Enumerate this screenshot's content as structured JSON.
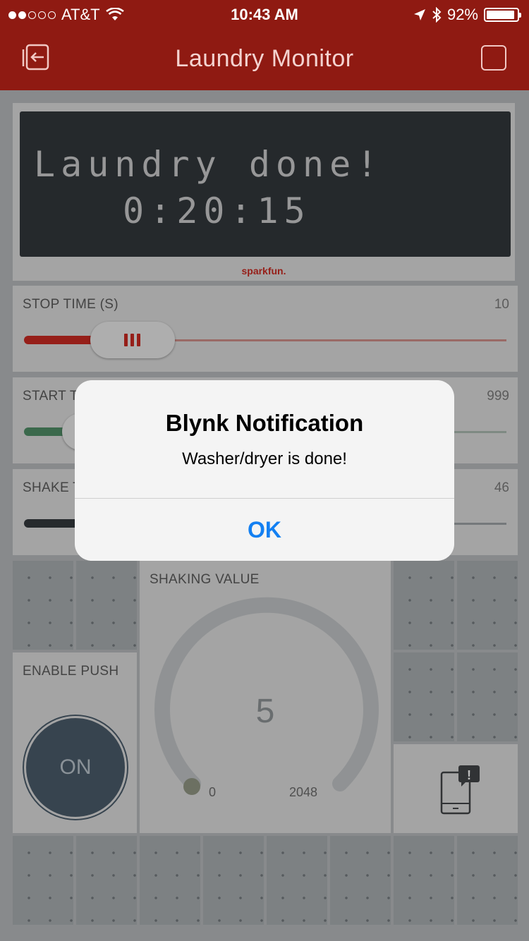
{
  "status_bar": {
    "carrier": "AT&T",
    "time": "10:43 AM",
    "battery_percent_label": "92%",
    "battery_level": 0.92,
    "signal_dots_filled": 2,
    "signal_dots_total": 5
  },
  "nav_bar": {
    "title": "Laundry Monitor",
    "background_color": "#8f1a12"
  },
  "lcd": {
    "line1": "Laundry done!",
    "line2": "0:20:15",
    "brand": "sparkfun."
  },
  "sliders": [
    {
      "label": "STOP TIME (S)",
      "value": "10",
      "color": "#c8231b"
    },
    {
      "label": "START T",
      "value": "999",
      "color": "#4a8a62"
    },
    {
      "label": "SHAKE T",
      "value": "46",
      "color": "#2d3337"
    }
  ],
  "gauge": {
    "label": "SHAKING VALUE",
    "value": "5",
    "min": "0",
    "max": "2048"
  },
  "push_toggle": {
    "label": "ENABLE PUSH",
    "state_label": "ON"
  },
  "notification_widget": {
    "badge": "!"
  },
  "alert": {
    "title": "Blynk Notification",
    "message": "Washer/dryer is done!",
    "button_label": "OK"
  },
  "colors": {
    "accent_red": "#c8231b",
    "alert_button_blue": "#1380f2",
    "toggle_blue": "#455766"
  }
}
